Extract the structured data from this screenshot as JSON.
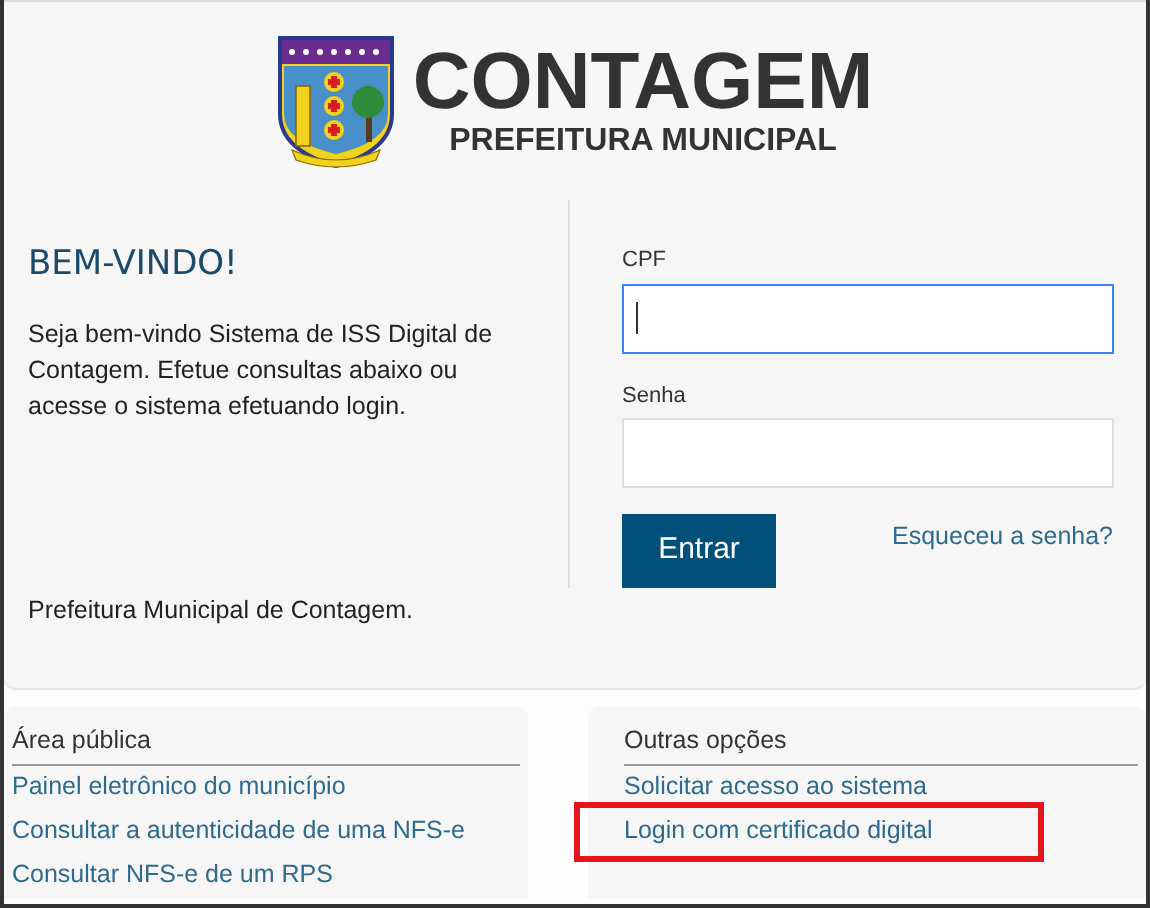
{
  "header": {
    "brand": "CONTAGEM",
    "subtitle": "PREFEITURA MUNICIPAL"
  },
  "welcome": {
    "title": "BEM-VINDO!",
    "text": "Seja bem-vindo Sistema de ISS Digital de Contagem. Efetue consultas abaixo ou acesse o sistema efetuando login.",
    "footer": "Prefeitura Municipal de Contagem."
  },
  "login": {
    "fields": [
      {
        "label": "CPF",
        "focused": true
      },
      {
        "label": "Senha",
        "focused": false
      }
    ],
    "button": "Entrar",
    "forgot_link": "Esqueceu a senha?"
  },
  "sections": [
    {
      "title": "Área pública",
      "links": [
        {
          "label": "Painel eletrônico do município",
          "highlighted": false
        },
        {
          "label": "Consultar a autenticidade de uma NFS-e",
          "highlighted": false
        },
        {
          "label": "Consultar NFS-e de um RPS",
          "highlighted": false
        }
      ]
    },
    {
      "title": "Outras opções",
      "links": [
        {
          "label": "Solicitar acesso ao sistema",
          "highlighted": false
        },
        {
          "label": "Login com certificado digital",
          "highlighted": true
        }
      ]
    }
  ]
}
